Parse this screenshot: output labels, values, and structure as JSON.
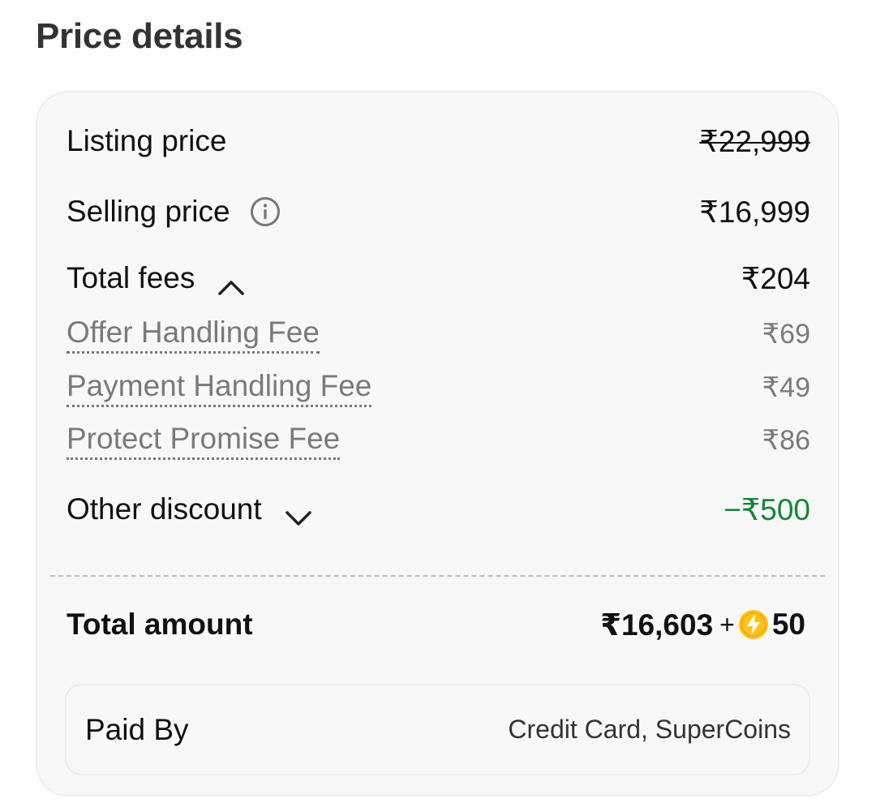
{
  "title": "Price details",
  "listing": {
    "label": "Listing price",
    "value": "₹22,999"
  },
  "selling": {
    "label": "Selling price",
    "value": "₹16,999",
    "icon": "info-icon"
  },
  "fees": {
    "label": "Total fees",
    "value": "₹204",
    "icon": "chevron-up-icon",
    "items": [
      {
        "label": "Offer Handling Fee",
        "value": "₹69"
      },
      {
        "label": "Payment Handling Fee",
        "value": "₹49"
      },
      {
        "label": "Protect Promise Fee",
        "value": "₹86"
      }
    ]
  },
  "discount": {
    "label": "Other discount",
    "value": "−₹500",
    "icon": "chevron-down-icon",
    "color": "#108934"
  },
  "total": {
    "label": "Total amount",
    "value": "₹16,603",
    "plus": "+",
    "coins": "50",
    "coin_icon": "supercoin-icon"
  },
  "paid_by": {
    "label": "Paid By",
    "value": "Credit Card, SuperCoins"
  },
  "colors": {
    "discount_green": "#108934",
    "coin_yellow": "#FFC21A",
    "card_bg": "#f8f8f8"
  }
}
